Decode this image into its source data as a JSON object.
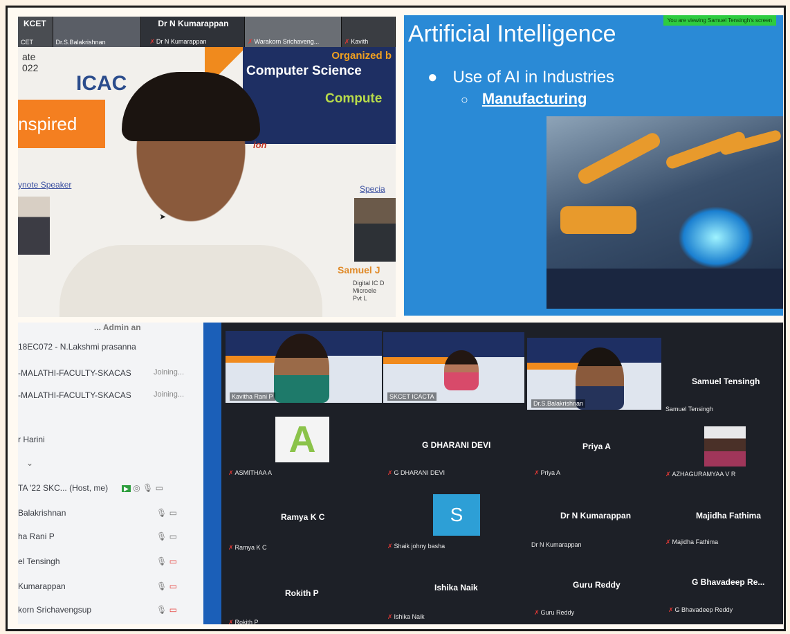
{
  "top_left": {
    "strip": [
      {
        "big": "KCET",
        "name": "CET"
      },
      {
        "big": "",
        "name": "Dr.S.Balakrishnan"
      },
      {
        "big": "Dr N Kumarappan",
        "name": "Dr N Kumarappan"
      },
      {
        "big": "",
        "name": "Warakorn Srichaveng..."
      },
      {
        "big": "",
        "name": "Kavith"
      }
    ],
    "side_date_1": "ate",
    "side_date_2": "022",
    "icac": "ICAC",
    "organized": "Organized b",
    "computer_science": "Computer Science",
    "compute": "Compute",
    "inspired": "nspired",
    "ion": "ion",
    "keynote": "ynote Speaker",
    "special": "Specia",
    "samuel": "Samuel J",
    "digital": "Digital IC D\nMicroele\nPvt L"
  },
  "slide": {
    "title": "Artificial Intelligence",
    "bullet_1": "Use of AI in Industries",
    "bullet_2": "Manufacturing",
    "viewing": "You are viewing Samuel Tensingh's screen"
  },
  "participants": {
    "top": "... Admin an",
    "rows": [
      {
        "label": "18EC072 - N.Lakshmi prasanna",
        "status": ""
      },
      {
        "label": "-MALATHI-FACULTY-SKACAS",
        "status": "Joining..."
      },
      {
        "label": "-MALATHI-FACULTY-SKACAS",
        "status": "Joining..."
      },
      {
        "label": "r Harini",
        "status": ""
      },
      {
        "label": "TA '22 SKC... (Host, me)",
        "status": ""
      },
      {
        "label": "Balakrishnan",
        "status": ""
      },
      {
        "label": "ha Rani P",
        "status": ""
      },
      {
        "label": "el Tensingh",
        "status": ""
      },
      {
        "label": "Kumarappan",
        "status": ""
      },
      {
        "label": "korn Srichavengsup",
        "status": ""
      }
    ]
  },
  "gallery": {
    "video_tiles": [
      {
        "label": "Kavitha Rani P"
      },
      {
        "label": "SKCET ICACTA"
      },
      {
        "label": "Dr.S.Balakrishnan"
      }
    ],
    "samuel_big": "Samuel Tensingh",
    "samuel_small": "Samuel Tensingh",
    "asmithaa": "ASMITHAA A",
    "dharani_big": "G DHARANI DEVI",
    "dharani_small": "G DHARANI DEVI",
    "priya_big": "Priya A",
    "priya_small": "Priya A",
    "azhaguramya": "AZHAGURAMYAA V R",
    "ramya_big": "Ramya K C",
    "ramya_small": "Ramya K C",
    "s_letter": "S",
    "shaik": "Shaik johny basha",
    "kumarappan_big": "Dr N Kumarappan",
    "kumarappan_small": "Dr N Kumarappan",
    "majidha_big": "Majidha Fathima",
    "majidha_small": "Majidha Fathima",
    "rokith_big": "Rokith P",
    "rokith_small": "Rokith P",
    "ishika_big": "Ishika Naik",
    "ishika_small": "Ishika Naik",
    "guru_big": "Guru Reddy",
    "guru_small": "Guru Reddy",
    "bhavadeep_big": "G Bhavadeep Re...",
    "bhavadeep_small": "G Bhavadeep Reddy",
    "a_letter": "A"
  }
}
